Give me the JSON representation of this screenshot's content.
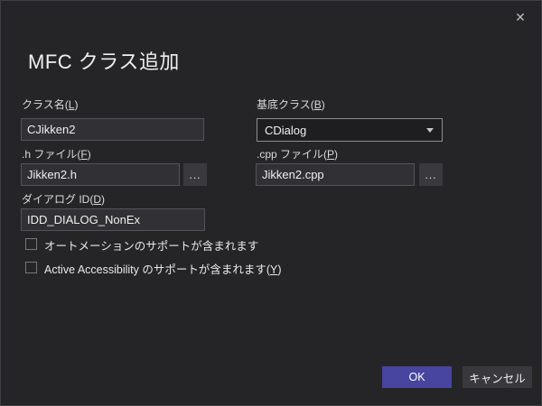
{
  "window": {
    "title": "MFC クラス追加",
    "close_icon": "✕"
  },
  "colors": {
    "background": "#252528",
    "accent_ok_button": "#4745a0",
    "gray_button": "#39393d",
    "input_background": "#313135",
    "combo_border": "#8e8e90"
  },
  "form": {
    "class_name": {
      "label_pre": "クラス名(",
      "label_key": "L",
      "label_post": ")",
      "value": "CJikken2"
    },
    "base_class": {
      "label_pre": "基底クラス(",
      "label_key": "B",
      "label_post": ")",
      "value": "CDialog"
    },
    "h_file": {
      "label_pre": ".h ファイル(",
      "label_key": "F",
      "label_post": ")",
      "value": "Jikken2.h",
      "browse_label": "..."
    },
    "cpp_file": {
      "label_pre": ".cpp ファイル(",
      "label_key": "P",
      "label_post": ")",
      "value": "Jikken2.cpp",
      "browse_label": "..."
    },
    "dialog_id": {
      "label_pre": "ダイアログ ID(",
      "label_key": "D",
      "label_post": ")",
      "value": "IDD_DIALOG_NonEx"
    },
    "automation_checkbox": {
      "label_pre": "オートメーションのサポートが含まれます",
      "label_key": "",
      "label_post": "",
      "checked": false
    },
    "accessibility_checkbox": {
      "label_pre": "Active Accessibility のサポートが含まれます(",
      "label_key": "Y",
      "label_post": ")",
      "checked": false
    }
  },
  "footer": {
    "ok_label": "OK",
    "cancel_label": "キャンセル"
  }
}
